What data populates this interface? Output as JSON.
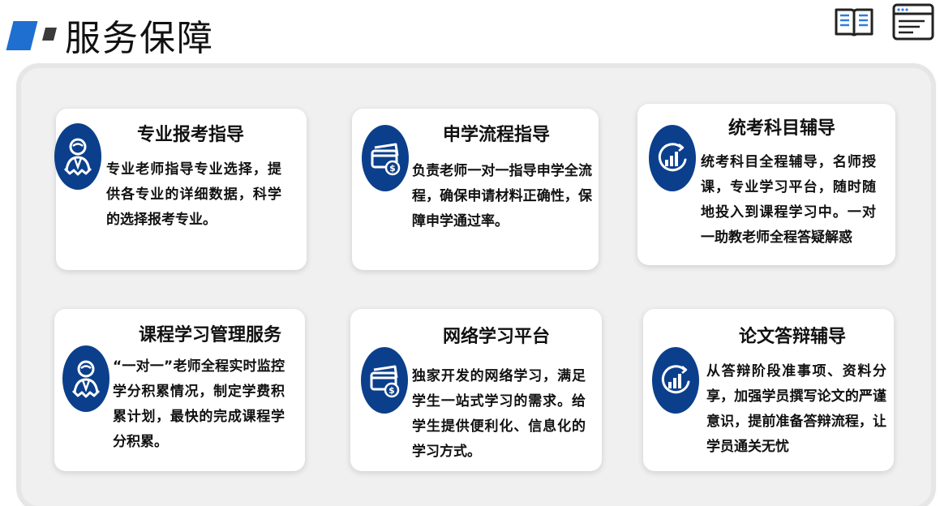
{
  "header": {
    "title": "服务保障",
    "icons": [
      "book-icon",
      "browser-window-icon"
    ]
  },
  "colors": {
    "accent": "#1e6fd0",
    "badge": "#0b3f8c",
    "panel": "#f0f0f0"
  },
  "cards": [
    {
      "title": "专业报考指导",
      "body": "专业老师指导专业选择，提供各专业的详细数据，科学的选择报考专业。",
      "icon": "advisor-icon"
    },
    {
      "title": "申学流程指导",
      "body": "负责老师一对一指导申学全流程，确保申请材料正确性，保障申学通过率。",
      "icon": "payment-card-icon"
    },
    {
      "title": "统考科目辅导",
      "body": "统考科目全程辅导，名师授课，专业学习平台，随时随地投入到课程学习中。一对一助教老师全程答疑解惑",
      "icon": "growth-chart-icon"
    },
    {
      "title": "课程学习管理服务",
      "body": "“一对一”老师全程实时监控学分积累情况，制定学费积累计划，最快的完成课程学分积累。",
      "icon": "advisor-icon"
    },
    {
      "title": "网络学习平台",
      "body": "独家开发的网络学习，满足学生一站式学习的需求。给学生提供便利化、信息化的学习方式。",
      "icon": "payment-card-icon"
    },
    {
      "title": "论文答辩辅导",
      "body": "从答辩阶段准事项、资料分享，加强学员撰写论文的严谨意识，提前准备答辩流程，让学员通关无忧",
      "icon": "growth-chart-icon"
    }
  ]
}
